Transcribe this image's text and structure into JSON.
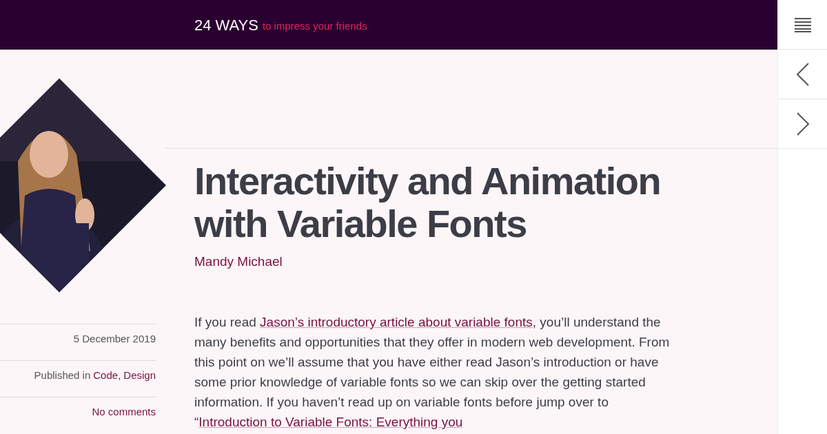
{
  "header": {
    "site_name": "24 WAYS",
    "tagline": "to impress your friends"
  },
  "side_nav": [
    {
      "kind": "menu"
    },
    {
      "kind": "previous"
    },
    {
      "kind": "next"
    }
  ],
  "article": {
    "title": "Interactivity and Animation with Variable Fonts",
    "author": "Mandy Michael",
    "meta": [
      {
        "kind": "date",
        "text": "5 December 2019"
      },
      {
        "kind": "categories",
        "label": "Published in",
        "links": [
          "Code",
          "Design"
        ],
        "separator": ","
      },
      {
        "kind": "comments",
        "text": "No comments"
      }
    ],
    "body": [
      {
        "kind": "text",
        "text": "If you read "
      },
      {
        "kind": "link",
        "text": "Jason’s introductory article about variable fonts"
      },
      {
        "kind": "text",
        "text": ", you’ll understand the many benefits and opportunities that they offer in modern web development. From this point on we’ll assume that you have either read Jason’s introduction or have some prior knowledge of variable fonts so we can skip over the getting started information. If you haven’t read up on variable fonts before jump over to “"
      },
      {
        "kind": "link",
        "text": "Introduction to Variable Fonts: Everything you"
      }
    ]
  }
}
